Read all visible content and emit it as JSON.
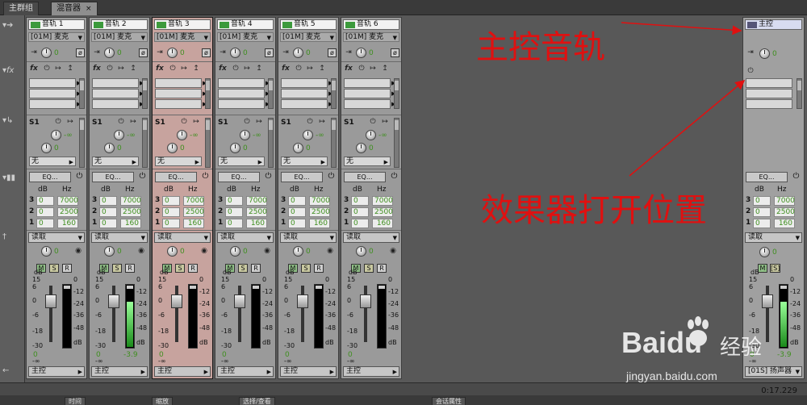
{
  "tabs": [
    {
      "label": "主群组",
      "active": false
    },
    {
      "label": "混音器",
      "active": true
    }
  ],
  "tab_close": "×",
  "tracks": [
    {
      "name": "音轨 1",
      "input": "[01M] 麦克",
      "send": "S1",
      "send_target": "无",
      "send_vol": "-∞",
      "pan": "0",
      "auto": "读取",
      "out": "主控",
      "vol": "0",
      "meter": "",
      "selected": false,
      "meter_level": 0
    },
    {
      "name": "音轨 2",
      "input": "[01M] 麦克",
      "send": "S1",
      "send_target": "无",
      "send_vol": "-∞",
      "pan": "0",
      "auto": "读取",
      "out": "主控",
      "vol": "0",
      "meter": "-3.9",
      "selected": false,
      "meter_level": 0.72
    },
    {
      "name": "音轨 3",
      "input": "[01M] 麦克",
      "send": "S1",
      "send_target": "无",
      "send_vol": "-∞",
      "pan": "0",
      "auto": "读取",
      "out": "主控",
      "vol": "0",
      "meter": "",
      "selected": true,
      "meter_level": 0
    },
    {
      "name": "音轨 4",
      "input": "[01M] 麦克",
      "send": "S1",
      "send_target": "无",
      "send_vol": "-∞",
      "pan": "0",
      "auto": "读取",
      "out": "主控",
      "vol": "0",
      "meter": "",
      "selected": false,
      "meter_level": 0
    },
    {
      "name": "音轨 5",
      "input": "[01M] 麦克",
      "send": "S1",
      "send_target": "无",
      "send_vol": "-∞",
      "pan": "0",
      "auto": "读取",
      "out": "主控",
      "vol": "0",
      "meter": "",
      "selected": false,
      "meter_level": 0
    },
    {
      "name": "音轨 6",
      "input": "[01M] 麦克",
      "send": "S1",
      "send_target": "无",
      "send_vol": "-∞",
      "pan": "0",
      "auto": "读取",
      "out": "主控",
      "vol": "0",
      "meter": "",
      "selected": false,
      "meter_level": 0
    }
  ],
  "master": {
    "name": "主控",
    "pan": "0",
    "auto": "读取",
    "out": "[01S] 扬声器",
    "vol": "0",
    "meter": "-3.9",
    "meter_level": 0.72
  },
  "eq": {
    "button": "EQ...",
    "hdr_db": "dB",
    "hdr_hz": "Hz",
    "bands": [
      {
        "num": "3",
        "db": "0",
        "hz": "7000"
      },
      {
        "num": "2",
        "db": "0",
        "hz": "2500"
      },
      {
        "num": "1",
        "db": "0",
        "hz": "160"
      }
    ]
  },
  "labels": {
    "fx": "fx",
    "m": "M",
    "s": "S",
    "r": "R",
    "s_master": "[S]",
    "db": "dB",
    "db_bottom": "dB"
  },
  "fader_scale": [
    "15",
    "6",
    "0",
    "-6",
    "-18",
    "-30",
    "-∞"
  ],
  "meter_scale": [
    "0",
    "-12",
    "-24",
    "-36",
    "-48"
  ],
  "timecode": "0:17.229",
  "bottom_tabs": [
    "时间",
    "缩放",
    "选择/查看",
    "会话属性"
  ],
  "annotations": [
    {
      "text": "主控音轨"
    },
    {
      "text": "效果器打开位置"
    }
  ],
  "watermark": {
    "brand": "Baidu",
    "cn": "经验",
    "url": "jingyan.baidu.com"
  },
  "colors": {
    "annotation": "#e01010",
    "selected_strip": "#c7a39e",
    "meter_green": "#1b8a1b",
    "value_green": "#3f8f1f"
  }
}
